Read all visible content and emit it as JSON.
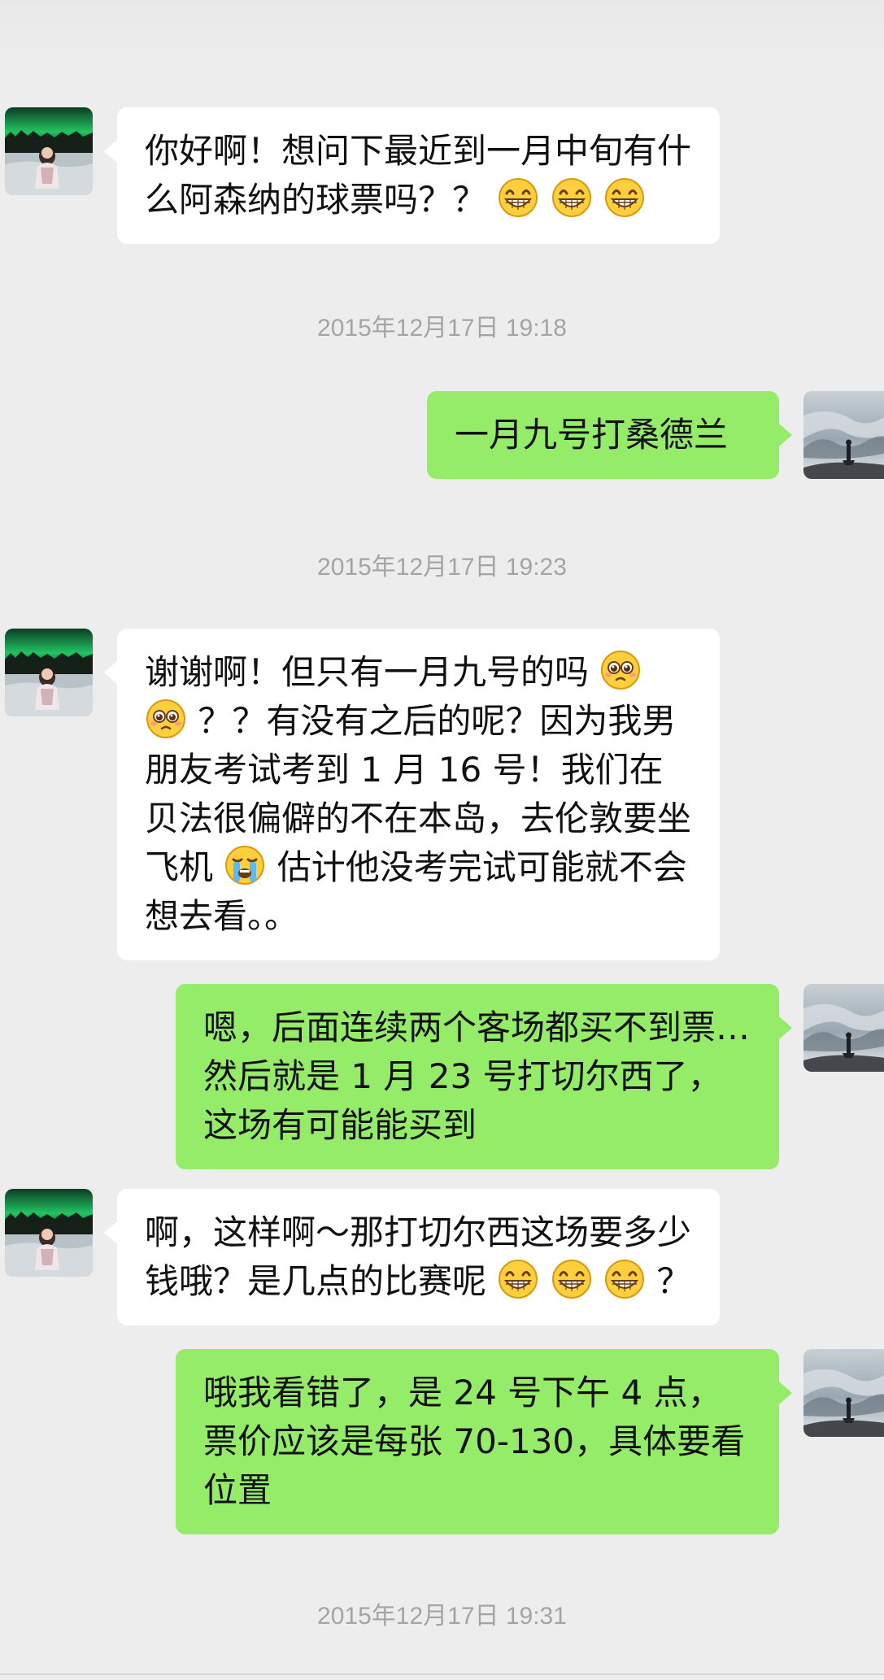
{
  "colors": {
    "background": "#ededed",
    "incoming_bubble": "#ffffff",
    "outgoing_bubble": "#95ec69",
    "timestamp_text": "#a4a4a4"
  },
  "messages": [
    {
      "sender": "contact",
      "text_before_emoji": "你好啊！想问下最近到一月中旬有什么阿森纳的球票吗？？",
      "emojis": [
        "grin-emoji",
        "grin-emoji",
        "grin-emoji"
      ]
    },
    {
      "type": "timestamp",
      "text": "2015年12月17日 19:18"
    },
    {
      "sender": "me",
      "text": "一月九号打桑德兰"
    },
    {
      "type": "timestamp",
      "text": "2015年12月17日 19:23"
    },
    {
      "sender": "contact",
      "part1": "谢谢啊！但只有一月九号的吗",
      "part2": "？？有没有之后的呢？因为我男朋友考试考到 1 月 16 号！我们在贝法很偏僻的不在本岛，去伦敦要坐飞机",
      "part3": "估计他没考完试可能就不会想去看。。",
      "emojis": [
        "pleading-emoji",
        "pleading-emoji",
        "crying-emoji"
      ]
    },
    {
      "sender": "me",
      "text": "嗯，后面连续两个客场都买不到票…然后就是 1 月 23 号打切尔西了，这场有可能能买到"
    },
    {
      "sender": "contact",
      "text_before_emoji": "啊，这样啊～那打切尔西这场要多少钱哦？是几点的比赛呢",
      "text_after_emoji": "？",
      "emojis": [
        "grin-emoji",
        "grin-emoji",
        "grin-emoji"
      ]
    },
    {
      "sender": "me",
      "text": "哦我看错了，是 24 号下午 4 点，票价应该是每张 70-130，具体要看位置"
    },
    {
      "type": "timestamp",
      "text": "2015年12月17日 19:31"
    }
  ]
}
